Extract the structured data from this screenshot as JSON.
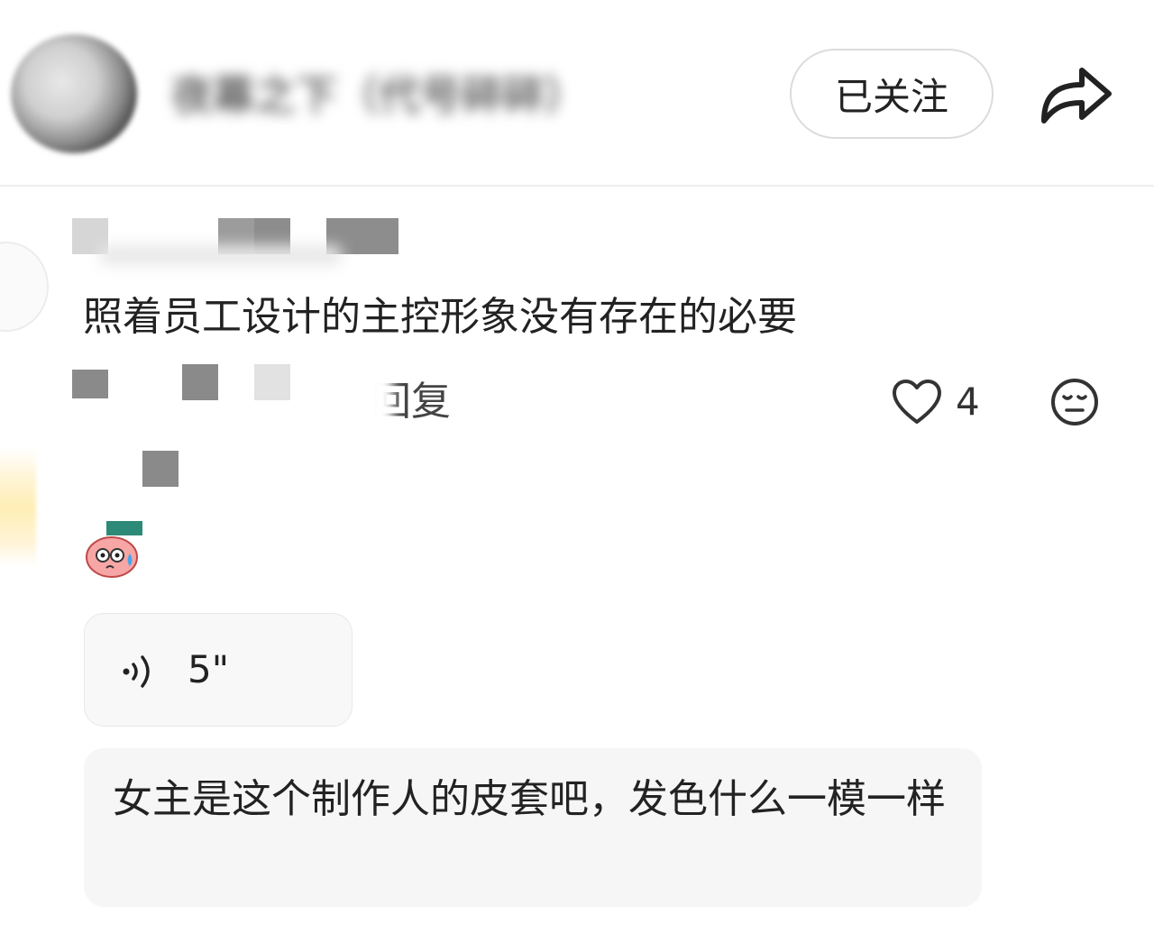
{
  "header": {
    "username": "夜幕之下（代号碎碎）",
    "follow_label": "已关注"
  },
  "comment": {
    "text": "照着员工设计的主控形象没有存在的必要",
    "reply_label": "回复",
    "like_count": "4"
  },
  "voice_message": {
    "duration": "5\""
  },
  "reply_preview": {
    "text": "女主是这个制作人的皮套吧，发色什么一模一样"
  },
  "icons": {
    "share": "share-arrow-icon",
    "like": "heart-outline-icon",
    "emoji": "meh-face-icon",
    "voice": "sound-wave-icon",
    "sticker": "pink-blob-sticker"
  },
  "colors": {
    "text": "#222222",
    "divider": "#eeeeee",
    "bubble": "#f6f6f6"
  }
}
